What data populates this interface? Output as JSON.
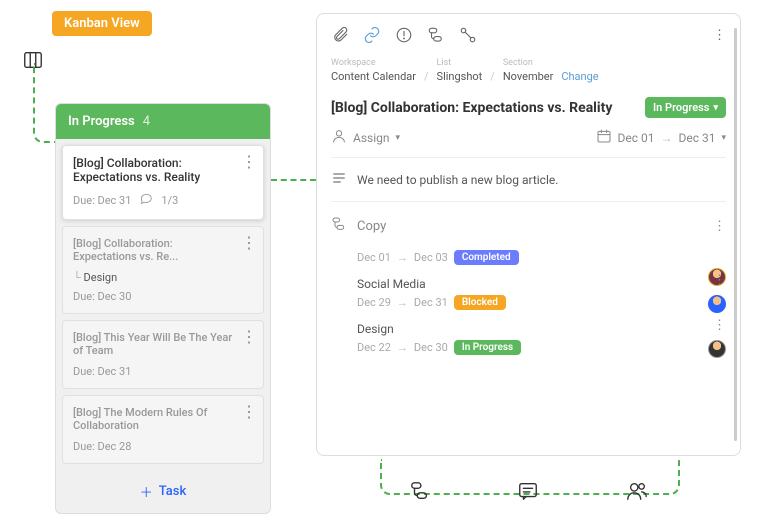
{
  "labels": {
    "kanban": "Kanban View"
  },
  "column": {
    "title": "In Progress",
    "count": "4",
    "add_task": "Task",
    "cards": [
      {
        "title": "[Blog] Collaboration: Expectations vs. Reality",
        "due": "Due:  Dec 31",
        "comments": "1/3"
      },
      {
        "parent": "[Blog] Collaboration: Expectations vs. Re...",
        "title": "Design",
        "due": "Due:  Dec 30"
      },
      {
        "title": "[Blog] This Year Will Be The Year of Team",
        "due": "Due:  Dec 31"
      },
      {
        "title": "[Blog] The Modern Rules Of Collaboration",
        "due": "Due:  Dec 28"
      }
    ]
  },
  "detail": {
    "breadcrumb": {
      "workspace_label": "Workspace",
      "workspace": "Content Calendar",
      "list_label": "List",
      "list": "Slingshot",
      "section_label": "Section",
      "section": "November",
      "change": "Change"
    },
    "title": "[Blog] Collaboration: Expectations vs. Reality",
    "status": "In Progress",
    "assign": "Assign",
    "date_start": "Dec 01",
    "date_end": "Dec 31",
    "description": "We need to publish a new blog article.",
    "subtasks_label": "Copy",
    "subtasks": [
      {
        "title": "",
        "start": "Dec 01",
        "end": "Dec 03",
        "status": "Completed",
        "pill_class": "completed"
      },
      {
        "title": "Social Media",
        "start": "Dec 29",
        "end": "Dec 31",
        "status": "Blocked",
        "pill_class": "blocked"
      },
      {
        "title": "Design",
        "start": "Dec 22",
        "end": "Dec 30",
        "status": "In Progress",
        "pill_class": "inprogress"
      }
    ]
  }
}
